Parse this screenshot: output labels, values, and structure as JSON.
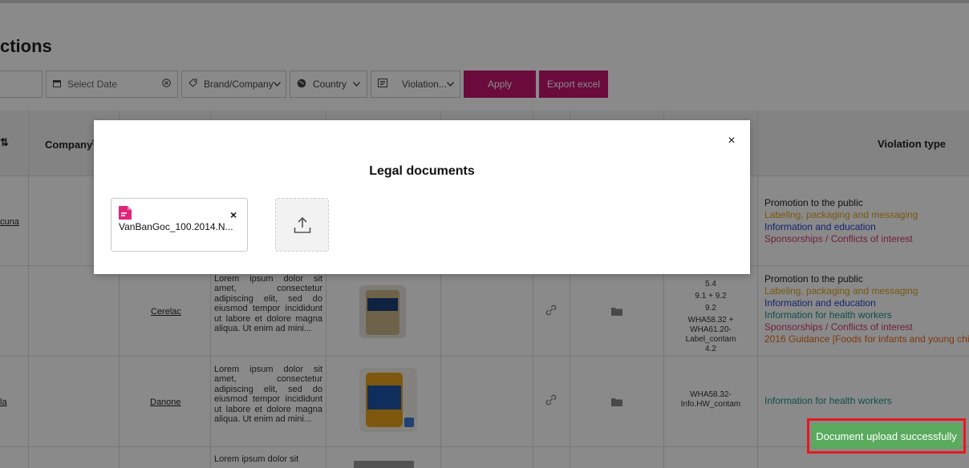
{
  "page": {
    "title": "ctions"
  },
  "filters": {
    "date_placeholder": "Select Date",
    "brand_label": "Brand/Company",
    "country_label": "Country",
    "violation_label": "Violation...",
    "apply_label": "Apply",
    "export_label": "Export excel"
  },
  "table": {
    "headers": {
      "sort_fragment": "⇅",
      "company": "Company",
      "company_sort": "↑",
      "violation_type": "Violation type"
    },
    "rows": [
      {
        "left_link": "cuna",
        "violation_types": [
          "Promotion to the public",
          "Labeling, packaging and messaging",
          "Information and education",
          "Sponsorships / Conflicts of interest"
        ]
      },
      {
        "company": "Cerelac",
        "description": "Lorem ipsum dolor sit amet, consectetur adipiscing elit, sed do eiusmod tempor incididunt ut labore et dolore magna aliqua. Ut enim ad mini...",
        "codes": [
          "5.4",
          "9.1 + 9.2",
          "9.2",
          "WHA58.32 +",
          "WHA61.20-",
          "Label_contam",
          "4.2"
        ],
        "violation_types": [
          "Promotion to the public",
          "Labeling, packaging and messaging",
          "Information and education",
          "Information for health workers",
          "Sponsorships / Conflicts of interest",
          "2016 Guidance [Foods for infants and young chil"
        ]
      },
      {
        "left_link": "la",
        "company": "Danone",
        "description": "Lorem ipsum dolor sit amet, consectetur adipiscing elit, sed do eiusmod tempor incididunt ut labore et dolore magna aliqua. Ut enim ad mini...",
        "codes": [
          "WHA58.32-",
          "Info.HW_contam"
        ],
        "violation_types": [
          "Information for health workers"
        ]
      },
      {
        "description": "Lorem ipsum dolor sit"
      }
    ]
  },
  "modal": {
    "title": "Legal documents",
    "close_icon": "×",
    "document": {
      "name": "VanBanGoc_100.2014.N...",
      "remove_icon": "×"
    },
    "upload_icon": "upload-icon"
  },
  "toast": {
    "message": "Document upload successfully"
  },
  "colors": {
    "accent": "#c4166f",
    "toast_bg": "#5aab5e",
    "toast_border": "#e51a1a",
    "vt_public": "#222222",
    "vt_labeling": "#e0a31c",
    "vt_info": "#2742c9",
    "vt_health": "#1e9484",
    "vt_sponsor": "#d13a6a",
    "vt_guidance": "#e86a1e"
  }
}
